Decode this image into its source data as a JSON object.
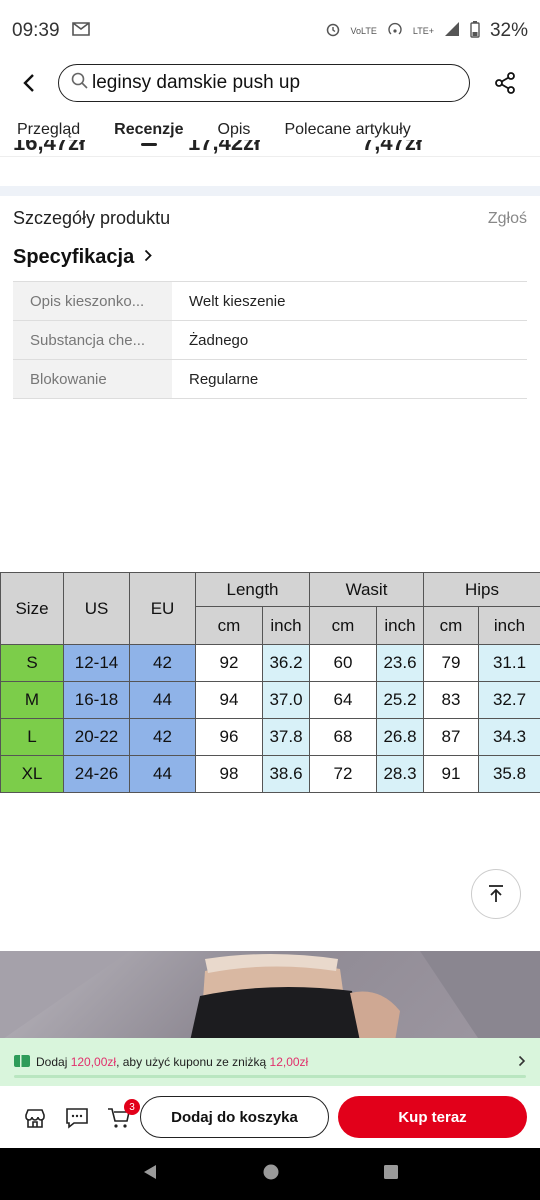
{
  "status_bar": {
    "time": "09:39",
    "notification_icon": "gmail-icon",
    "network": "LTE+",
    "volte": "VoLTE",
    "battery": "32%"
  },
  "search": {
    "query": "leginsy damskie push up"
  },
  "tabs": [
    {
      "label": "Przegląd"
    },
    {
      "label": "Recenzje",
      "active": true
    },
    {
      "label": "Opis"
    },
    {
      "label": "Polecane artykuły"
    }
  ],
  "prices_partial": [
    "16,47zł",
    "17,42zł",
    "7,47zł"
  ],
  "details": {
    "title": "Szczegóły produktu",
    "report": "Zgłoś",
    "spec_title": "Specyfikacja",
    "rows": [
      {
        "key": "Opis kieszonko...",
        "value": "Welt kieszenie"
      },
      {
        "key": "Substancja che...",
        "value": "Żadnego"
      },
      {
        "key": "Blokowanie",
        "value": "Regularne"
      }
    ]
  },
  "size_chart": {
    "headers": {
      "size": "Size",
      "us": "US",
      "eu": "EU",
      "length": "Length",
      "waist": "Wasit",
      "hips": "Hips",
      "cm": "cm",
      "inch": "inch"
    },
    "rows": [
      {
        "size": "S",
        "us": "12-14",
        "eu": "42",
        "len_cm": "92",
        "len_in": "36.2",
        "w_cm": "60",
        "w_in": "23.6",
        "h_cm": "79",
        "h_in": "31.1"
      },
      {
        "size": "M",
        "us": "16-18",
        "eu": "44",
        "len_cm": "94",
        "len_in": "37.0",
        "w_cm": "64",
        "w_in": "25.2",
        "h_cm": "83",
        "h_in": "32.7"
      },
      {
        "size": "L",
        "us": "20-22",
        "eu": "42",
        "len_cm": "96",
        "len_in": "37.8",
        "w_cm": "68",
        "w_in": "26.8",
        "h_cm": "87",
        "h_in": "34.3"
      },
      {
        "size": "XL",
        "us": "24-26",
        "eu": "44",
        "len_cm": "98",
        "len_in": "38.6",
        "w_cm": "72",
        "w_in": "28.3",
        "h_cm": "91",
        "h_in": "35.8"
      }
    ]
  },
  "coupon": {
    "prefix": "Dodaj",
    "amount": "120,00zł",
    "middle": ", aby użyć kuponu ze zniżką",
    "discount": "12,00zł"
  },
  "bottom_bar": {
    "cart_count": "3",
    "add_to_cart": "Dodaj do koszyka",
    "buy_now": "Kup teraz"
  },
  "colors": {
    "accent": "#e2001a",
    "coupon_bg": "#d9f5dc",
    "coupon_amount": "#e1306c"
  }
}
